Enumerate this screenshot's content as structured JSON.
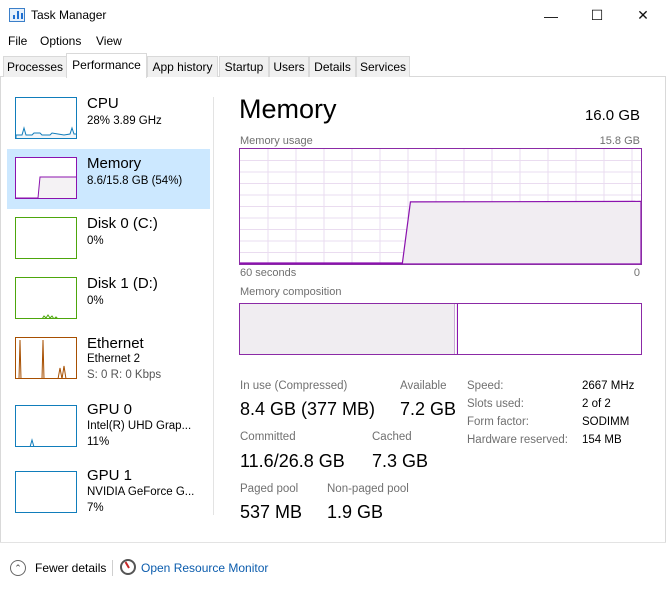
{
  "window": {
    "title": "Task Manager",
    "minimize_glyph": "—",
    "maximize_glyph": "☐",
    "close_glyph": "✕"
  },
  "menu": [
    "File",
    "Options",
    "View"
  ],
  "tabs": [
    {
      "label": "Processes",
      "active": false
    },
    {
      "label": "Performance",
      "active": true
    },
    {
      "label": "App history",
      "active": false
    },
    {
      "label": "Startup",
      "active": false
    },
    {
      "label": "Users",
      "active": false
    },
    {
      "label": "Details",
      "active": false
    },
    {
      "label": "Services",
      "active": false
    }
  ],
  "sidebar": [
    {
      "title": "CPU",
      "line1": "28%  3.89 GHz",
      "line2": "",
      "color": "#117dbb",
      "selected": false,
      "icon": "cpu-graph"
    },
    {
      "title": "Memory",
      "line1": "8.6/15.8 GB (54%)",
      "line2": "",
      "color": "#8b12ae",
      "selected": true,
      "icon": "memory-graph"
    },
    {
      "title": "Disk 0 (C:)",
      "line1": "0%",
      "line2": "",
      "color": "#4da60c",
      "selected": false,
      "icon": "disk-graph"
    },
    {
      "title": "Disk 1 (D:)",
      "line1": "0%",
      "line2": "",
      "color": "#4da60c",
      "selected": false,
      "icon": "disk-graph"
    },
    {
      "title": "Ethernet",
      "line1": "Ethernet 2",
      "line2": "S: 0  R: 0 Kbps",
      "color": "#a74f01",
      "selected": false,
      "icon": "ethernet-graph"
    },
    {
      "title": "GPU 0",
      "line1": "Intel(R) UHD Grap...",
      "line2": "11%",
      "color": "#117dbb",
      "selected": false,
      "icon": "gpu-graph"
    },
    {
      "title": "GPU 1",
      "line1": "NVIDIA GeForce G...",
      "line2": "7%",
      "color": "#117dbb",
      "selected": false,
      "icon": "gpu-graph"
    }
  ],
  "memory": {
    "title": "Memory",
    "total": "16.0 GB",
    "usage_label": "Memory usage",
    "usage_max": "15.8 GB",
    "time_label": "60 seconds",
    "time_end": "0",
    "composition_label": "Memory composition",
    "stats": {
      "in_use_label": "In use (Compressed)",
      "in_use_value": "8.4 GB (377 MB)",
      "available_label": "Available",
      "available_value": "7.2 GB",
      "committed_label": "Committed",
      "committed_value": "11.6/26.8 GB",
      "cached_label": "Cached",
      "cached_value": "7.3 GB",
      "paged_label": "Paged pool",
      "paged_value": "537 MB",
      "nonpaged_label": "Non-paged pool",
      "nonpaged_value": "1.9 GB"
    },
    "details": [
      {
        "label": "Speed:",
        "value": "2667 MHz"
      },
      {
        "label": "Slots used:",
        "value": "2 of 2"
      },
      {
        "label": "Form factor:",
        "value": "SODIMM"
      },
      {
        "label": "Hardware reserved:",
        "value": "154 MB"
      }
    ],
    "usage_fraction": 0.54,
    "accent_color": "#8b12ae"
  },
  "footer": {
    "fewer_details": "Fewer details",
    "open_monitor": "Open Resource Monitor",
    "fewer_icon_glyph": "⌃"
  }
}
